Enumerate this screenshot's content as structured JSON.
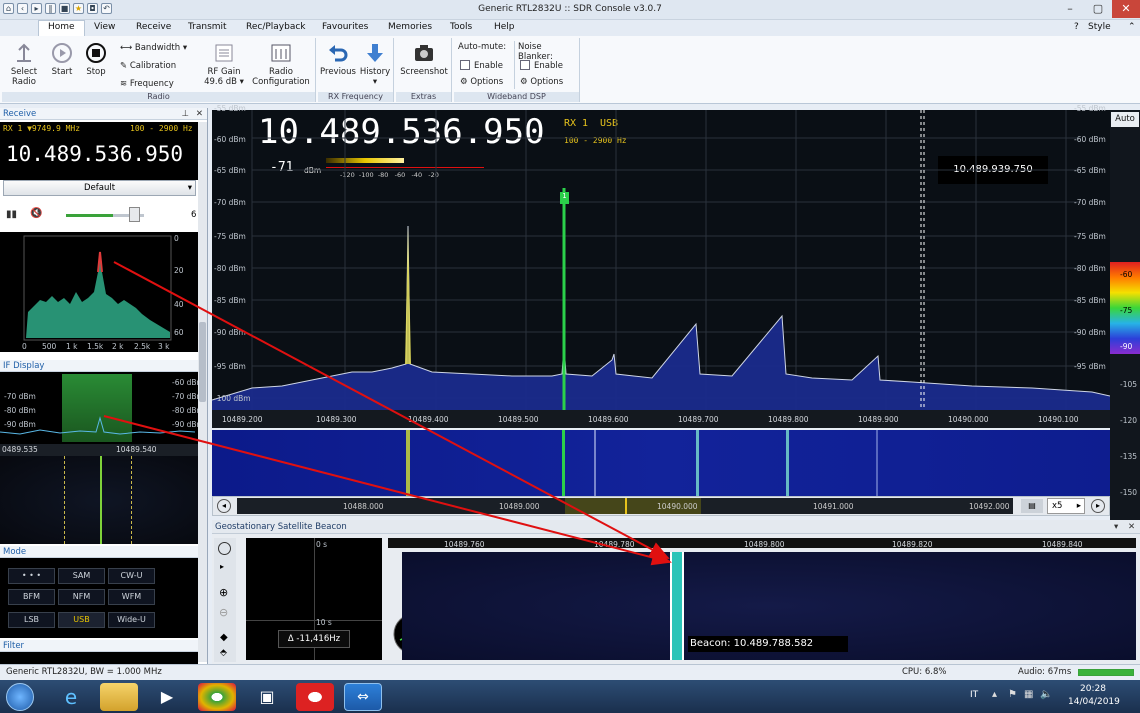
{
  "window": {
    "title": "Generic RTL2832U :: SDR Console v3.0.7"
  },
  "menu": {
    "items": [
      "Home",
      "View",
      "Receive",
      "Transmit",
      "Rec/Playback",
      "Favourites",
      "Memories",
      "Tools",
      "Help"
    ],
    "style": "Style"
  },
  "ribbon": {
    "radio": {
      "label": "Radio",
      "select_radio": "Select Radio",
      "start": "Start",
      "stop": "Stop",
      "bandwidth": "Bandwidth",
      "calibration": "Calibration",
      "frequency": "Frequency",
      "rf_gain": "RF Gain",
      "rf_gain_value": "49.6 dB",
      "radio_config": "Radio Configuration"
    },
    "rxfreq": {
      "label": "RX Frequency",
      "previous": "Previous",
      "history": "History"
    },
    "extras": {
      "label": "Extras",
      "screenshot": "Screenshot"
    },
    "wdsp": {
      "label": "Wideband DSP",
      "automute": "Auto-mute:",
      "noiseblanker": "Noise Blanker:",
      "enable": "Enable",
      "options": "Options"
    }
  },
  "receive": {
    "header": "Receive",
    "rx_line": "RX 1 ▼9749.9 MHz",
    "bw_line": "100 - 2900 Hz",
    "freq": "10.489.536.950",
    "preset": "Default",
    "volume_end": "6",
    "audio_ticks": [
      "0",
      "500",
      "1 k",
      "1.5k",
      "2 k",
      "2.5k",
      "3 k"
    ],
    "audio_db": [
      "0",
      "20",
      "40",
      "60"
    ]
  },
  "if_display": {
    "header": "IF Display",
    "db": [
      "-60 dBm",
      "-70 dBm",
      "-80 dBm",
      "-90 dBm"
    ],
    "f1": "0489.535",
    "f2": "10489.540"
  },
  "mode": {
    "header": "Mode",
    "buttons": [
      "• • •",
      "SAM",
      "CW-U",
      "BFM",
      "NFM",
      "WFM",
      "LSB",
      "USB",
      "Wide-U"
    ],
    "selected": "USB"
  },
  "filter": {
    "header": "Filter"
  },
  "spectrum": {
    "freq": "10.489.536.950",
    "rx": "RX 1",
    "mode": "USB",
    "bw": "100 - 2900 Hz",
    "dbm": "-71",
    "dbm_unit": "dBm",
    "scale": [
      "-120",
      "-100",
      "-80",
      "-60",
      "-40",
      "-20"
    ],
    "cursor_freq": "10.489.939.750",
    "auto": "Auto",
    "ylabels": [
      "-55 dBm",
      "-60 dBm",
      "-65 dBm",
      "-70 dBm",
      "-75 dBm",
      "-80 dBm",
      "-85 dBm",
      "-90 dBm",
      "-95 dBm",
      "-100 dBm"
    ],
    "xlabels": [
      "10489.200",
      "10489.300",
      "10489.400",
      "10489.500",
      "10489.600",
      "10489.700",
      "10489.800",
      "10489.900",
      "10490.000",
      "10490.100"
    ],
    "marker": "1",
    "colorbar": [
      "-60",
      "-75",
      "-90",
      "-105",
      "-120",
      "-135",
      "-150"
    ],
    "band": [
      "10488.000",
      "10489.000",
      "10490.000",
      "10491.000",
      "10492.000"
    ],
    "zoom": "x5"
  },
  "beacon": {
    "title": "Geostationary Satellite Beacon",
    "delta": "Δ -11,416Hz",
    "t0": "0 s",
    "t10": "10 s",
    "freqs": [
      "10489.760",
      "10489.780",
      "10489.800",
      "10489.820",
      "10489.840"
    ],
    "beacon": "Beacon: 10.489.788.582"
  },
  "status": {
    "device": "Generic RTL2832U, BW = 1.000 MHz",
    "cpu": "CPU: 6.8%",
    "audio": "Audio: 67ms"
  },
  "taskbar": {
    "lang": "IT",
    "time": "20:28",
    "date": "14/04/2019"
  },
  "colors": {
    "accent": "#1f5fa8",
    "spectrum_bg": "#0a0f15",
    "signal_green": "#2bd14a",
    "annotation": "#e01010"
  }
}
